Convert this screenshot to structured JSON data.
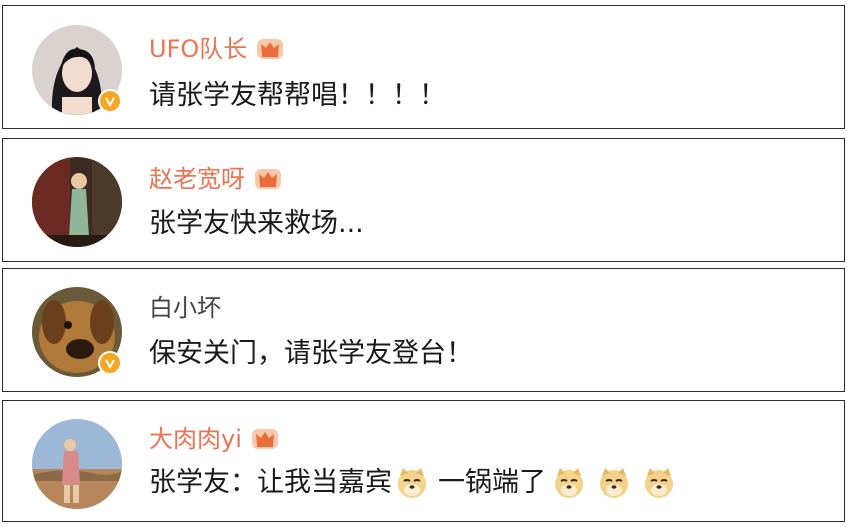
{
  "comments": [
    {
      "username": "UFO队长",
      "text": "请张学友帮帮唱！！！！",
      "vip": true,
      "verified": true
    },
    {
      "username": "赵老宽呀",
      "text": "张学友快来救场...",
      "vip": true,
      "verified": false
    },
    {
      "username": "白小坏",
      "text": "保安关门，请张学友登台！",
      "vip": false,
      "verified": true
    },
    {
      "username": "大肉肉yi",
      "text_part1": "张学友：让我当嘉宾",
      "text_part2": "一锅端了",
      "vip": true,
      "verified": false
    }
  ],
  "colors": {
    "vip_name": "#eb7350",
    "plain_name": "#444444",
    "verified_badge": "#f5a623",
    "border": "#2a2a2a"
  },
  "icons": {
    "vip": "crown-icon",
    "verified": "verified-v-icon",
    "emoji": "doge-emoji-icon"
  }
}
